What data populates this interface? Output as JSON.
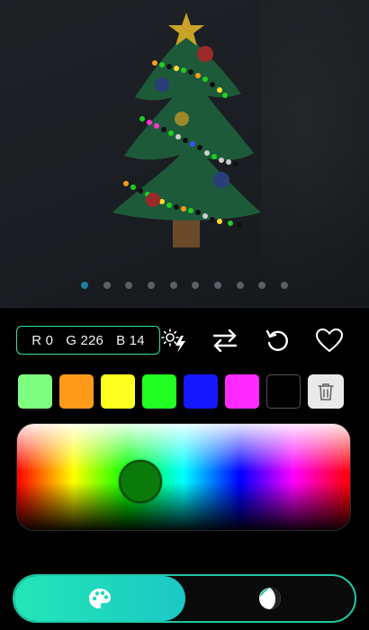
{
  "preview": {
    "pager": {
      "count": 10,
      "active_index": 0
    }
  },
  "controls": {
    "rgb": {
      "r": "R 0",
      "g": "G 226",
      "b": "B 14"
    },
    "icons": [
      "brightness-flash-icon",
      "swap-icon",
      "reset-icon",
      "favorite-icon"
    ]
  },
  "swatches": {
    "colors": [
      "#7fff7f",
      "#ff9a1a",
      "#ffff22",
      "#22ff22",
      "#1717ff",
      "#ff2aff",
      "#000000"
    ],
    "delete_icon": "trash-icon"
  },
  "picker": {
    "selected_color": "#0a7a0a"
  },
  "mode_bar": {
    "active": "palette",
    "modes": [
      "palette-icon",
      "gradient-ball-icon"
    ]
  },
  "colors": {
    "accent": "#1ec7a6",
    "border_accent": "#36e0a8"
  }
}
